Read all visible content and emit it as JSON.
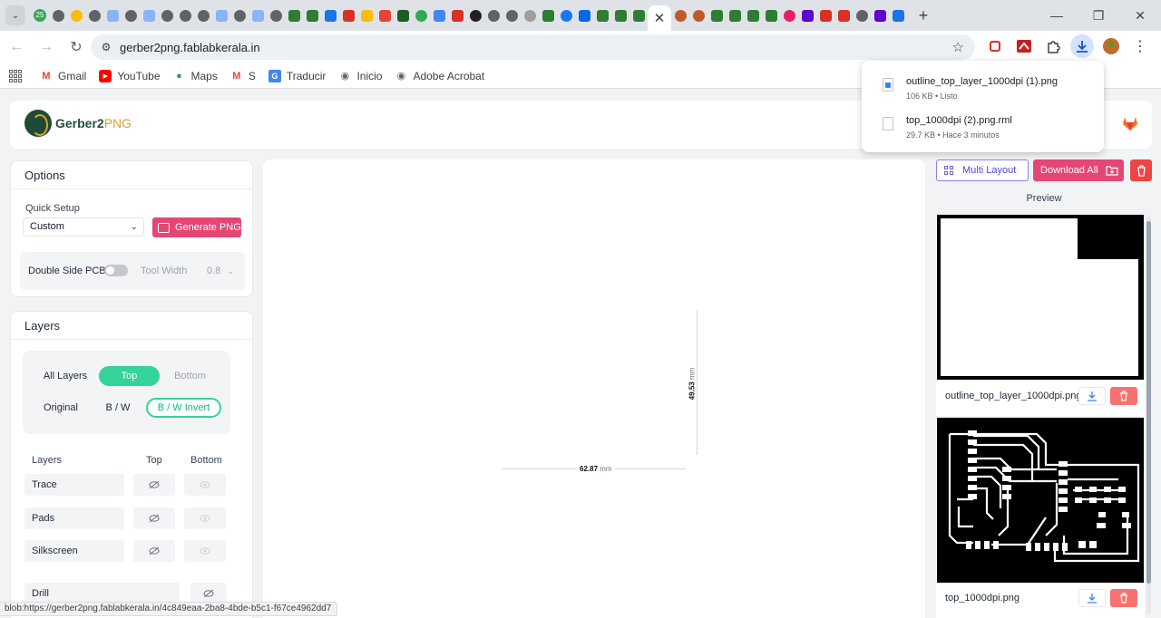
{
  "browser": {
    "active_tab_close": "✕",
    "new_tab": "+",
    "url": "gerber2png.fablabkerala.in",
    "status_url": "blob:https://gerber2png.fablabkerala.in/4c849eaa-2ba8-4bde-b5c1-f67ce4962dd7",
    "tab_badge": "25"
  },
  "bookmarks": [
    {
      "label": "Gmail",
      "icon": "gmail-icon",
      "glyph": "M",
      "color": "#ea4335"
    },
    {
      "label": "YouTube",
      "icon": "youtube-icon",
      "glyph": "▶",
      "color": "#ff0000"
    },
    {
      "label": "Maps",
      "icon": "maps-icon",
      "glyph": "●",
      "color": "#34a853"
    },
    {
      "label": "S",
      "icon": "gmail-icon",
      "glyph": "M",
      "color": "#ea4335"
    },
    {
      "label": "Traducir",
      "icon": "translate-icon",
      "glyph": "G",
      "color": "#4285f4"
    },
    {
      "label": "Inicio",
      "icon": "globe-icon",
      "glyph": "◉",
      "color": "#5f6368"
    },
    {
      "label": "Adobe Acrobat",
      "icon": "globe-icon",
      "glyph": "◉",
      "color": "#5f6368"
    }
  ],
  "downloads": [
    {
      "name": "outline_top_layer_1000dpi (1).png",
      "meta": "106 KB • Listo",
      "kind": "image"
    },
    {
      "name": "top_1000dpi (2).png.rml",
      "meta": "29.7 KB • Hace 3 minutos",
      "kind": "file"
    }
  ],
  "app": {
    "logo_primary": "Gerber2",
    "logo_accent": "PNG",
    "options": {
      "title": "Options",
      "quick_setup_label": "Quick Setup",
      "quick_setup_value": "Custom",
      "generate_label": "Generate PNG",
      "double_side_label": "Double Side PCB",
      "tool_width_label": "Tool Width",
      "tool_width_value": "0.8"
    },
    "layers": {
      "title": "Layers",
      "side_tabs": [
        "All Layers",
        "Top",
        "Bottom"
      ],
      "mode_tabs": [
        "Original",
        "B / W",
        "B / W Invert"
      ],
      "columns": [
        "Layers",
        "Top",
        "Bottom"
      ],
      "rows": [
        "Trace",
        "Pads",
        "Silkscreen",
        "Drill"
      ]
    },
    "canvas": {
      "width_value": "62.87",
      "height_value": "49.53",
      "unit": "mm"
    },
    "right": {
      "multi_layout_label": "Multi Layout",
      "download_all_label": "Download All",
      "preview_title": "Preview",
      "previews": [
        {
          "filename": "outline_top_layer_1000dpi.png"
        },
        {
          "filename": "top_1000dpi.png"
        }
      ]
    }
  },
  "colors": {
    "accent_pink": "#e44775",
    "accent_green": "#34d399",
    "accent_indigo": "#4f46e5",
    "danger": "#ef4444"
  }
}
